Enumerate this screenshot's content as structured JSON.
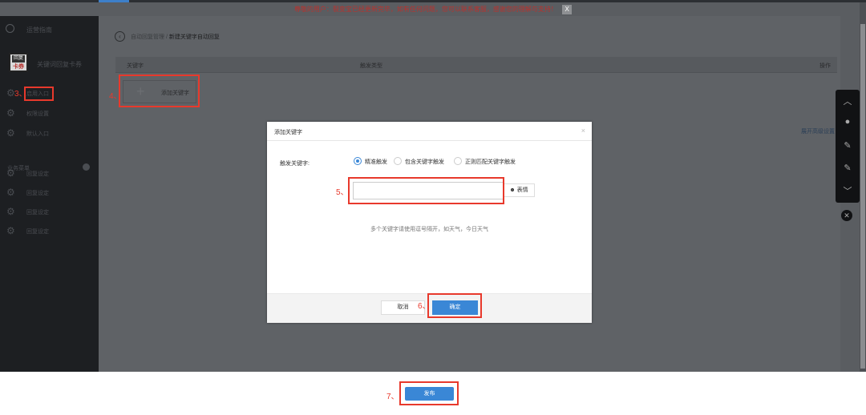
{
  "notice": {
    "text": "尊敬的用户：裂变宝已经更新完毕，如有任何问题，您可以联系客服，感谢您的理解与支持！",
    "close": "X"
  },
  "sidebar": {
    "back_label": "运营指南",
    "logo_top": "回复",
    "logo_bottom": "卡券",
    "title": "关键词回复卡券",
    "items": [
      {
        "label": "启用入口"
      },
      {
        "label": "权限设置"
      },
      {
        "label": "默认入口"
      }
    ],
    "group_label": "业务菜单",
    "sub_items": [
      {
        "label": "回复设定"
      },
      {
        "label": "回复设定"
      },
      {
        "label": "回复设定"
      },
      {
        "label": "回复设定"
      }
    ]
  },
  "breadcrumb": {
    "parent": "自动回复管理 / ",
    "current": "新建关键字自动回复"
  },
  "table": {
    "headers": [
      "关键字",
      "触发类型",
      "操作"
    ],
    "add_label": "添加关键字",
    "add_icon": "+"
  },
  "advanced_link": "展开高级设置",
  "modal": {
    "title": "添加关键字",
    "close": "×",
    "field_label": "触发关键字:",
    "options": [
      {
        "label": "精准触发",
        "selected": true
      },
      {
        "label": "包含关键字触发",
        "selected": false
      },
      {
        "label": "正则匹配关键字触发",
        "selected": false
      }
    ],
    "input_value": "",
    "input_placeholder": "",
    "emoji_label": "表情",
    "hint": "多个关键字请使用逗号隔开，如天气，今日天气",
    "cancel_label": "取消",
    "ok_label": "确定"
  },
  "publish_label": "发布",
  "annotations": {
    "step3": "3、",
    "step4": "4、",
    "step5": "5、",
    "step6": "6、",
    "step7": "7、"
  },
  "colors": {
    "accent": "#3a87d6",
    "annotation": "#e8392c",
    "notice": "#b8322e"
  }
}
